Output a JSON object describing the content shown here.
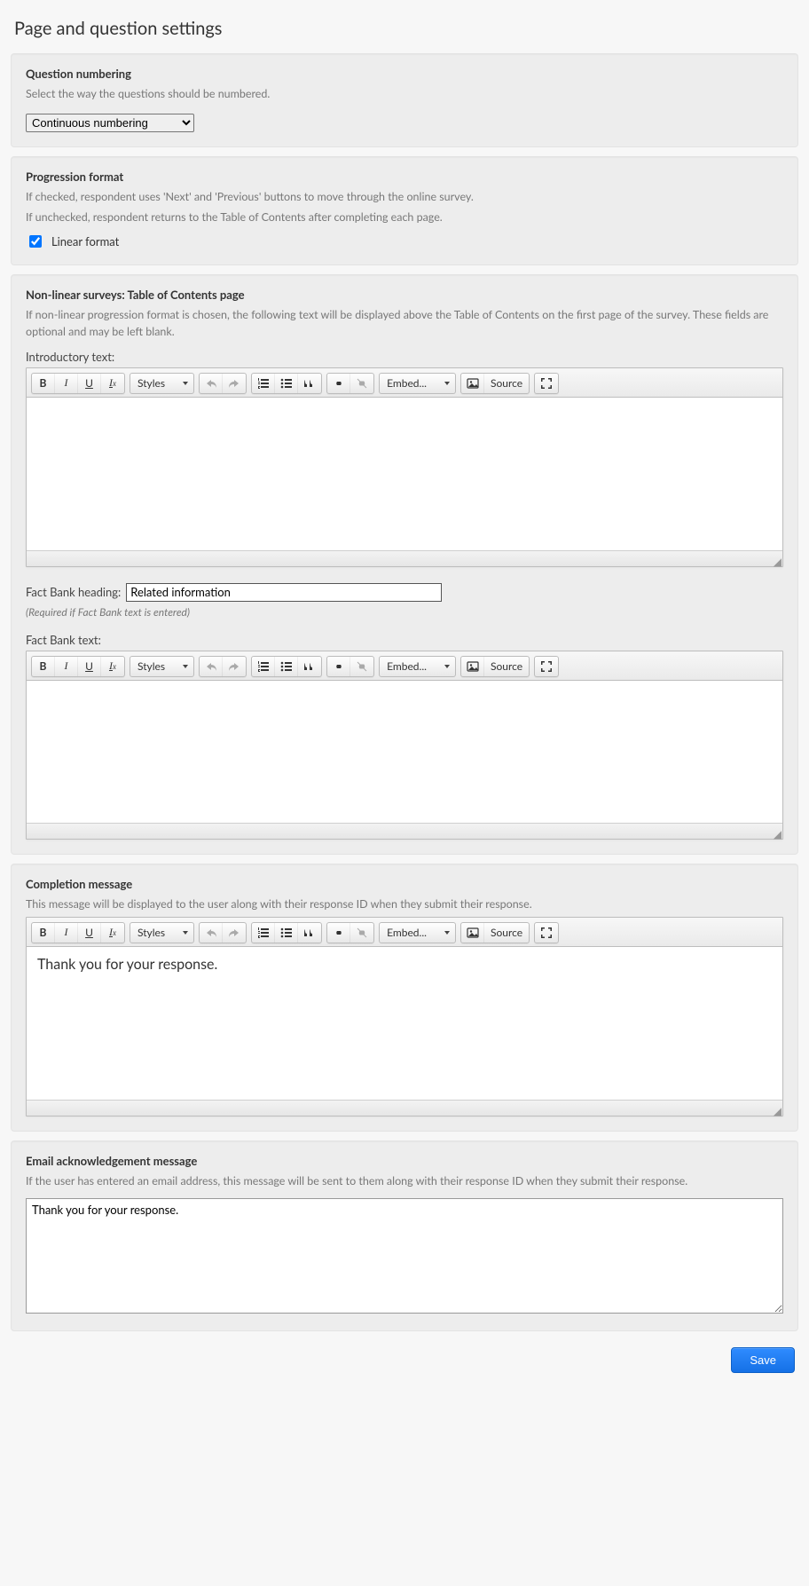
{
  "page": {
    "title": "Page and question settings"
  },
  "numbering": {
    "heading": "Question numbering",
    "help": "Select the way the questions should be numbered.",
    "selected": "Continuous numbering",
    "options": [
      "Continuous numbering"
    ]
  },
  "progression": {
    "heading": "Progression format",
    "help1": "If checked, respondent uses 'Next' and 'Previous' buttons to move through the online survey.",
    "help2": "If unchecked, respondent returns to the Table of Contents after completing each page.",
    "checkbox_label": "Linear format",
    "checked": true
  },
  "toc": {
    "heading": "Non-linear surveys: Table of Contents page",
    "help": "If non-linear progression format is chosen, the following text will be displayed above the Table of Contents on the first page of the survey. These fields are optional and may be left blank.",
    "intro_label": "Introductory text:",
    "intro_value": "",
    "factbank_heading_label": "Fact Bank heading:",
    "factbank_heading_value": "Related information",
    "factbank_heading_note": "(Required if Fact Bank text is entered)",
    "factbank_text_label": "Fact Bank text:",
    "factbank_text_value": ""
  },
  "completion": {
    "heading": "Completion message",
    "help": "This message will be displayed to the user along with their response ID when they submit their response.",
    "value": "Thank you for your response."
  },
  "email_ack": {
    "heading": "Email acknowledgement message",
    "help": "If the user has entered an email address, this message will be sent to them along with their response ID when they submit their response.",
    "value": "Thank you for your response."
  },
  "editor": {
    "styles_label": "Styles",
    "embed_label": "Embed...",
    "source_label": "Source"
  },
  "actions": {
    "save": "Save"
  }
}
